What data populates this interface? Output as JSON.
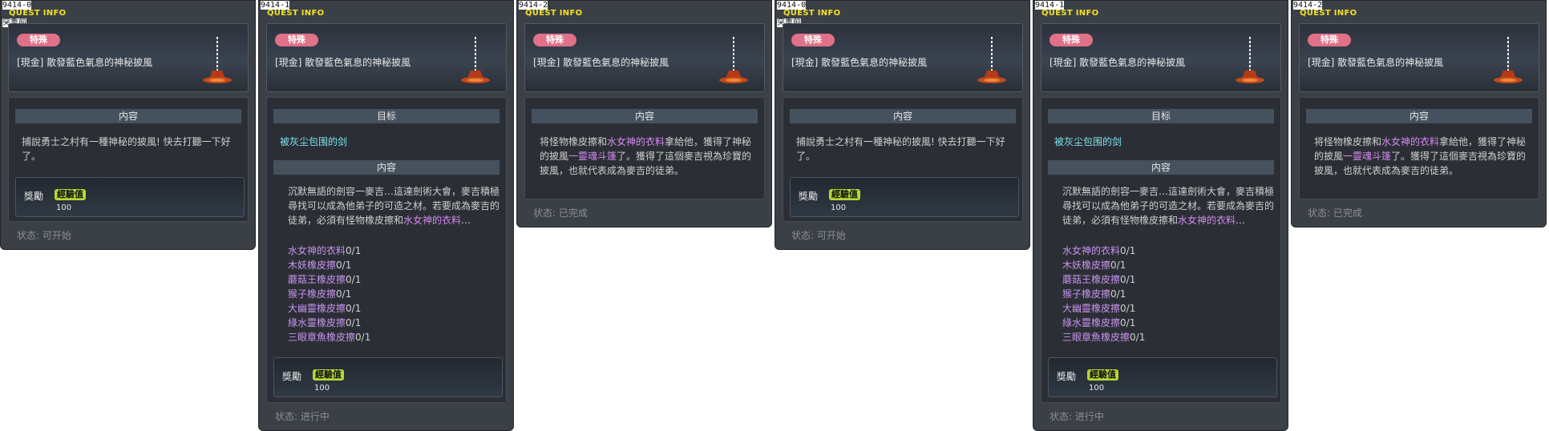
{
  "colors": {
    "panel_bg": "#3b4046",
    "title": "#f2e026",
    "tag": "#e07189",
    "exp_badge": "#b5d836",
    "highlight": "#d58af0",
    "target": "#7de2ee"
  },
  "icons": {
    "quest_item": "cape-icon"
  },
  "panels": [
    {
      "id": "9414-0",
      "sub": "突重前",
      "title": "QUEST INFO",
      "tag": "特殊",
      "name": "[現金] 散發藍色氣息的神秘披風",
      "content_header": "内容",
      "content": [
        "捕說勇士之村有一種神秘的披風! 快去打聽一下好",
        "了。"
      ],
      "reward_label": "獎勵",
      "exp_label": "經驗值",
      "exp_value": "100",
      "status": "状态:  可开始"
    },
    {
      "id": "9414-1",
      "title": "QUEST INFO",
      "tag": "特殊",
      "name": "[現金] 散發藍色氣息的神秘披風",
      "target_header": "目标",
      "target_text": "被灰尘包围的剑",
      "content_header": "内容",
      "content_l1": "沉默無語的劍容一麥吉…這達劍術大會，麥吉積極",
      "content_l2": "尋找可以成為他弟子的可造之材。若要成為麥吉的",
      "content_l3a": "徒弟，必須有怪物橡皮擦和",
      "content_l3b": "水女神的衣料",
      "content_l3c": "…",
      "items": [
        {
          "name": "水女神的衣料",
          "count": "0/1"
        },
        {
          "name": "木妖橡皮擦",
          "count": "0/1"
        },
        {
          "name": "蘑菇王橡皮擦",
          "count": "0/1"
        },
        {
          "name": "猴子橡皮擦",
          "count": "0/1"
        },
        {
          "name": "大幽靈橡皮擦",
          "count": "0/1"
        },
        {
          "name": "綠水靈橡皮擦",
          "count": "0/1"
        },
        {
          "name": "三眼章魚橡皮擦",
          "count": "0/1"
        }
      ],
      "reward_label": "獎勵",
      "exp_label": "經驗值",
      "exp_value": "100",
      "status": "状态:  进行中"
    },
    {
      "id": "9414-2",
      "title": "QUEST INFO",
      "tag": "特殊",
      "name": "[現金] 散發藍色氣息的神秘披風",
      "content_header": "内容",
      "c_l1a": "将怪物橡皮擦和",
      "c_l1b": "水女神的衣料",
      "c_l1c": "拿給他，獲得了神秘",
      "c_l2a": "的披風",
      "c_l2b": "一靈魂斗篷",
      "c_l2c": "了。獲得了這個麥吉視為珍寶的",
      "c_l3": "披風，也就代表成為麥吉的徒弟。",
      "status": "状态:  已完成"
    }
  ]
}
